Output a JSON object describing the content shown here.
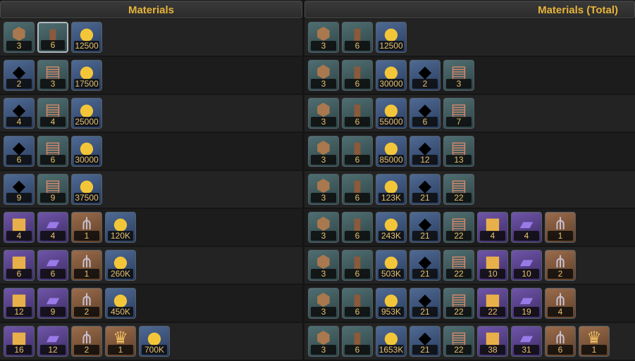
{
  "header": {
    "left_title": "Materials",
    "right_title": "Materials (Total)"
  },
  "icon_kinds": {
    "ore": {
      "name": "ore-icon",
      "glyph": "⬢",
      "bg": "teal"
    },
    "book": {
      "name": "book-icon",
      "glyph": "▮",
      "bg": "teal"
    },
    "gold": {
      "name": "gold-coin-icon",
      "glyph": "●",
      "bg": "blue"
    },
    "crystal": {
      "name": "crystal-icon",
      "glyph": "◆",
      "bg": "blue"
    },
    "scroll": {
      "name": "scroll-icon",
      "glyph": "▤",
      "bg": "teal"
    },
    "cube": {
      "name": "cube-icon",
      "glyph": "■",
      "bg": "purple"
    },
    "tome": {
      "name": "tome-icon",
      "glyph": "▰",
      "bg": "purple"
    },
    "claw": {
      "name": "claw-icon",
      "glyph": "⋔",
      "bg": "orange"
    },
    "crown": {
      "name": "crown-icon",
      "glyph": "♛",
      "bg": "orange"
    }
  },
  "materials": [
    [
      {
        "icon": "ore",
        "count": "3"
      },
      {
        "icon": "book",
        "count": "6",
        "selected": true
      },
      {
        "icon": "gold",
        "count": "12500"
      }
    ],
    [
      {
        "icon": "crystal",
        "count": "2"
      },
      {
        "icon": "scroll",
        "count": "3"
      },
      {
        "icon": "gold",
        "count": "17500"
      }
    ],
    [
      {
        "icon": "crystal",
        "count": "4"
      },
      {
        "icon": "scroll",
        "count": "4"
      },
      {
        "icon": "gold",
        "count": "25000"
      }
    ],
    [
      {
        "icon": "crystal",
        "count": "6"
      },
      {
        "icon": "scroll",
        "count": "6"
      },
      {
        "icon": "gold",
        "count": "30000"
      }
    ],
    [
      {
        "icon": "crystal",
        "count": "9"
      },
      {
        "icon": "scroll",
        "count": "9"
      },
      {
        "icon": "gold",
        "count": "37500"
      }
    ],
    [
      {
        "icon": "cube",
        "count": "4"
      },
      {
        "icon": "tome",
        "count": "4"
      },
      {
        "icon": "claw",
        "count": "1"
      },
      {
        "icon": "gold",
        "count": "120K"
      }
    ],
    [
      {
        "icon": "cube",
        "count": "6"
      },
      {
        "icon": "tome",
        "count": "6"
      },
      {
        "icon": "claw",
        "count": "1"
      },
      {
        "icon": "gold",
        "count": "260K"
      }
    ],
    [
      {
        "icon": "cube",
        "count": "12"
      },
      {
        "icon": "tome",
        "count": "9"
      },
      {
        "icon": "claw",
        "count": "2"
      },
      {
        "icon": "gold",
        "count": "450K"
      }
    ],
    [
      {
        "icon": "cube",
        "count": "16"
      },
      {
        "icon": "tome",
        "count": "12"
      },
      {
        "icon": "claw",
        "count": "2"
      },
      {
        "icon": "crown",
        "count": "1"
      },
      {
        "icon": "gold",
        "count": "700K"
      }
    ]
  ],
  "materials_total": [
    [
      {
        "icon": "ore",
        "count": "3"
      },
      {
        "icon": "book",
        "count": "6"
      },
      {
        "icon": "gold",
        "count": "12500"
      }
    ],
    [
      {
        "icon": "ore",
        "count": "3"
      },
      {
        "icon": "book",
        "count": "6"
      },
      {
        "icon": "gold",
        "count": "30000"
      },
      {
        "icon": "crystal",
        "count": "2"
      },
      {
        "icon": "scroll",
        "count": "3"
      }
    ],
    [
      {
        "icon": "ore",
        "count": "3"
      },
      {
        "icon": "book",
        "count": "6"
      },
      {
        "icon": "gold",
        "count": "55000"
      },
      {
        "icon": "crystal",
        "count": "6"
      },
      {
        "icon": "scroll",
        "count": "7"
      }
    ],
    [
      {
        "icon": "ore",
        "count": "3"
      },
      {
        "icon": "book",
        "count": "6"
      },
      {
        "icon": "gold",
        "count": "85000"
      },
      {
        "icon": "crystal",
        "count": "12"
      },
      {
        "icon": "scroll",
        "count": "13"
      }
    ],
    [
      {
        "icon": "ore",
        "count": "3"
      },
      {
        "icon": "book",
        "count": "6"
      },
      {
        "icon": "gold",
        "count": "123K"
      },
      {
        "icon": "crystal",
        "count": "21"
      },
      {
        "icon": "scroll",
        "count": "22"
      }
    ],
    [
      {
        "icon": "ore",
        "count": "3"
      },
      {
        "icon": "book",
        "count": "6"
      },
      {
        "icon": "gold",
        "count": "243K"
      },
      {
        "icon": "crystal",
        "count": "21"
      },
      {
        "icon": "scroll",
        "count": "22"
      },
      {
        "icon": "cube",
        "count": "4"
      },
      {
        "icon": "tome",
        "count": "4"
      },
      {
        "icon": "claw",
        "count": "1"
      }
    ],
    [
      {
        "icon": "ore",
        "count": "3"
      },
      {
        "icon": "book",
        "count": "6"
      },
      {
        "icon": "gold",
        "count": "503K"
      },
      {
        "icon": "crystal",
        "count": "21"
      },
      {
        "icon": "scroll",
        "count": "22"
      },
      {
        "icon": "cube",
        "count": "10"
      },
      {
        "icon": "tome",
        "count": "10"
      },
      {
        "icon": "claw",
        "count": "2"
      }
    ],
    [
      {
        "icon": "ore",
        "count": "3"
      },
      {
        "icon": "book",
        "count": "6"
      },
      {
        "icon": "gold",
        "count": "953K"
      },
      {
        "icon": "crystal",
        "count": "21"
      },
      {
        "icon": "scroll",
        "count": "22"
      },
      {
        "icon": "cube",
        "count": "22"
      },
      {
        "icon": "tome",
        "count": "19"
      },
      {
        "icon": "claw",
        "count": "4"
      }
    ],
    [
      {
        "icon": "ore",
        "count": "3"
      },
      {
        "icon": "book",
        "count": "6"
      },
      {
        "icon": "gold",
        "count": "1653K"
      },
      {
        "icon": "crystal",
        "count": "21"
      },
      {
        "icon": "scroll",
        "count": "22"
      },
      {
        "icon": "cube",
        "count": "38"
      },
      {
        "icon": "tome",
        "count": "31"
      },
      {
        "icon": "claw",
        "count": "6"
      },
      {
        "icon": "crown",
        "count": "1"
      }
    ]
  ]
}
